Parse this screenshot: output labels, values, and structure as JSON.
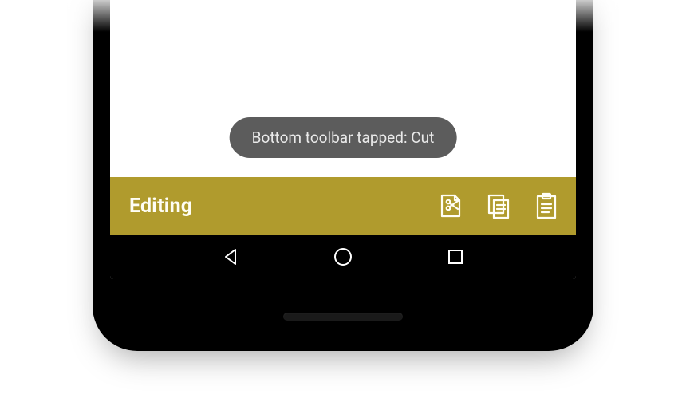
{
  "toast": {
    "message": "Bottom toolbar tapped: Cut"
  },
  "toolbar": {
    "title": "Editing",
    "actions": [
      {
        "name": "cut"
      },
      {
        "name": "copy"
      },
      {
        "name": "paste"
      }
    ]
  },
  "colors": {
    "toolbar_bg": "#b09b2d",
    "toast_bg": "#5c5c5c"
  }
}
